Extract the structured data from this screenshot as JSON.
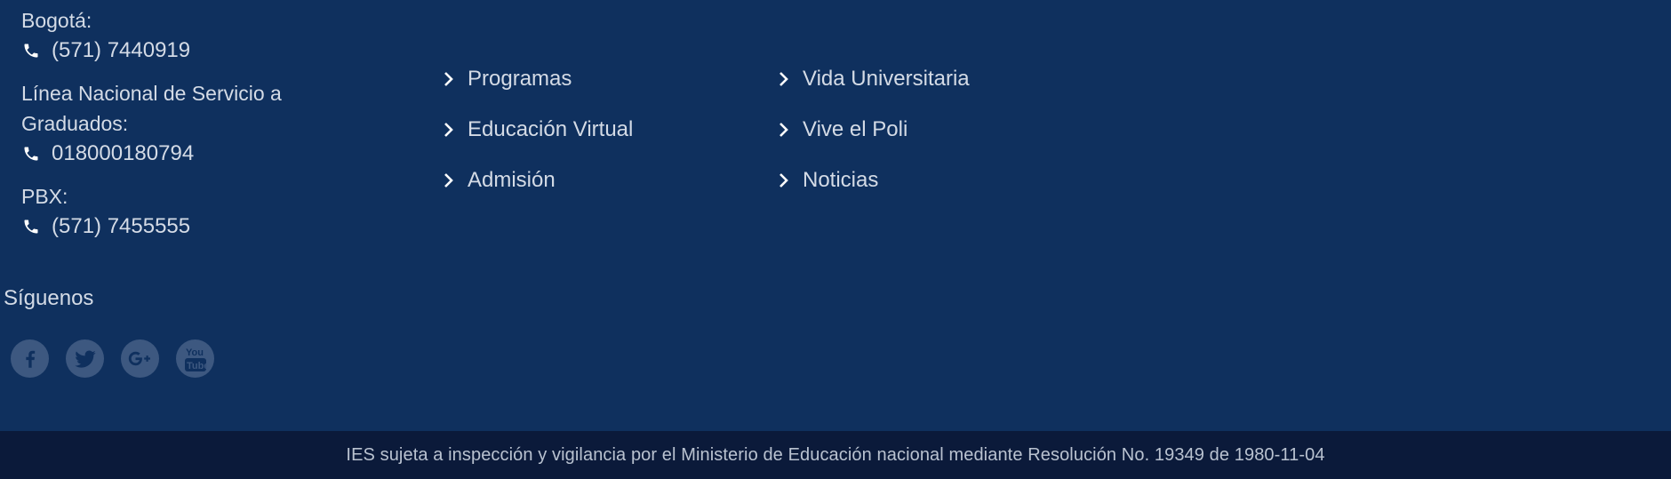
{
  "contact": {
    "bogota": {
      "label": "Bogotá:",
      "phone": "(571) 7440919"
    },
    "national": {
      "label_line1": "Línea Nacional de Servicio a",
      "label_line2": "Graduados:",
      "phone": "018000180794"
    },
    "pbx": {
      "label": "PBX:",
      "phone": "(571) 7455555"
    }
  },
  "social": {
    "label": "Síguenos",
    "items": [
      {
        "icon": "facebook-icon"
      },
      {
        "icon": "twitter-icon"
      },
      {
        "icon": "google-plus-icon"
      },
      {
        "icon": "youtube-icon"
      }
    ]
  },
  "links": {
    "col1": [
      "Programas",
      "Educación Virtual",
      "Admisión"
    ],
    "col2": [
      "Vida Universitaria",
      "Vive el Poli",
      "Noticias"
    ]
  },
  "bottom_bar": {
    "text": "IES sujeta a inspección y vigilancia por el Ministerio de Educación nacional mediante Resolución No. 19349 de 1980-11-04"
  },
  "colors": {
    "footer_bg": "#0f305e",
    "bottom_bg": "#0b1a3a",
    "social_circle": "#3d5880",
    "text": "#d4dbe6"
  }
}
